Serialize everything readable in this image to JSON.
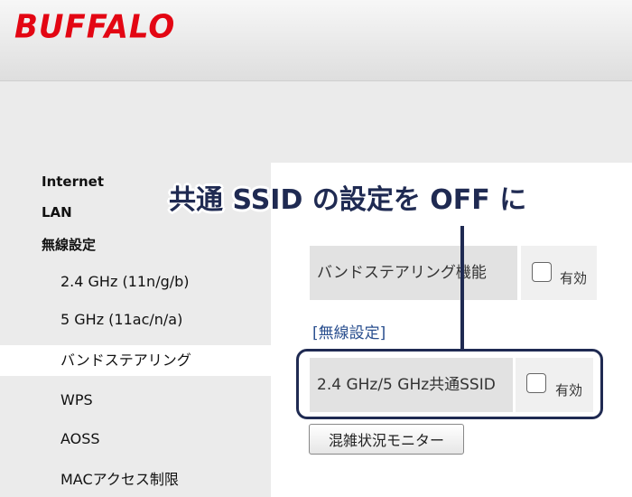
{
  "brand": {
    "logo_text": "BUFFALO",
    "logo_color": "#e30613"
  },
  "sidebar": {
    "items": [
      {
        "label": "Internet"
      },
      {
        "label": "LAN"
      },
      {
        "label": "無線設定"
      },
      {
        "label": "2.4 GHz (11n/g/b)"
      },
      {
        "label": "5 GHz (11ac/n/a)"
      },
      {
        "label": "バンドステアリング",
        "active": true
      },
      {
        "label": "WPS"
      },
      {
        "label": "AOSS"
      },
      {
        "label": "MACアクセス制限"
      }
    ]
  },
  "main": {
    "band_steering": {
      "label": "バンドステアリング機能",
      "checkbox_label": "有効",
      "checked": false
    },
    "section_title": "[無線設定]",
    "shared_ssid": {
      "label": "2.4 GHz/5 GHz共通SSID",
      "checkbox_label": "有効",
      "checked": false
    },
    "monitor_button": "混雑状況モニター"
  },
  "annotation": {
    "caption": "共通 SSID の設定を OFF に",
    "color": "#1f2a52"
  }
}
